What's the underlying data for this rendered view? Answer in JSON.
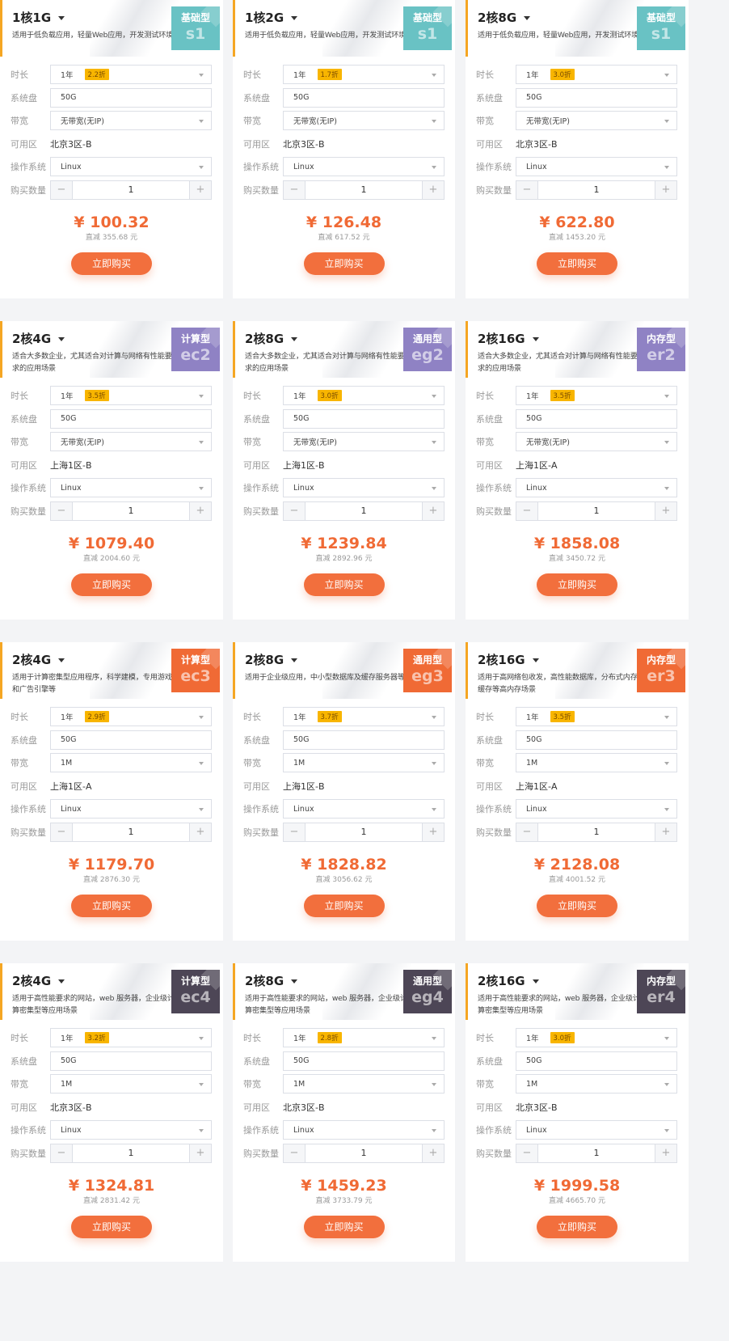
{
  "row_labels": {
    "duration": "时长",
    "disk": "系统盘",
    "bandwidth": "带宽",
    "zone": "可用区",
    "os": "操作系统",
    "quantity": "购买数量"
  },
  "cards": [
    {
      "spec": "1核1G",
      "desc": "适用于低负载应用，轻量Web应用，开发测试环境",
      "type": "基础型",
      "code": "s1",
      "badge_color": "#69c2c4",
      "duration": "1年",
      "discount": "2.2折",
      "disk": "50G",
      "bandwidth": "无带宽(无IP)",
      "zone": "北京3区-B",
      "os": "Linux",
      "qty": "1",
      "price": "¥ 100.32",
      "save": "直减 355.68 元",
      "buy": "立即购买"
    },
    {
      "spec": "1核2G",
      "desc": "适用于低负载应用，轻量Web应用，开发测试环境",
      "type": "基础型",
      "code": "s1",
      "badge_color": "#69c2c4",
      "duration": "1年",
      "discount": "1.7折",
      "disk": "50G",
      "bandwidth": "无带宽(无IP)",
      "zone": "北京3区-B",
      "os": "Linux",
      "qty": "1",
      "price": "¥ 126.48",
      "save": "直减 617.52 元",
      "buy": "立即购买"
    },
    {
      "spec": "2核8G",
      "desc": "适用于低负载应用，轻量Web应用，开发测试环境",
      "type": "基础型",
      "code": "s1",
      "badge_color": "#69c2c4",
      "duration": "1年",
      "discount": "3.0折",
      "disk": "50G",
      "bandwidth": "无带宽(无IP)",
      "zone": "北京3区-B",
      "os": "Linux",
      "qty": "1",
      "price": "¥ 622.80",
      "save": "直减 1453.20 元",
      "buy": "立即购买"
    },
    {
      "spec": "2核4G",
      "desc": "适合大多数企业，尤其适合对计算与网络有性能要求的应用场景",
      "type": "计算型",
      "code": "ec2",
      "badge_color": "#8f82c4",
      "duration": "1年",
      "discount": "3.5折",
      "disk": "50G",
      "bandwidth": "无带宽(无IP)",
      "zone": "上海1区-B",
      "os": "Linux",
      "qty": "1",
      "price": "¥ 1079.40",
      "save": "直减 2004.60 元",
      "buy": "立即购买"
    },
    {
      "spec": "2核8G",
      "desc": "适合大多数企业，尤其适合对计算与网络有性能要求的应用场景",
      "type": "通用型",
      "code": "eg2",
      "badge_color": "#8f82c4",
      "duration": "1年",
      "discount": "3.0折",
      "disk": "50G",
      "bandwidth": "无带宽(无IP)",
      "zone": "上海1区-B",
      "os": "Linux",
      "qty": "1",
      "price": "¥ 1239.84",
      "save": "直减 2892.96 元",
      "buy": "立即购买"
    },
    {
      "spec": "2核16G",
      "desc": "适合大多数企业，尤其适合对计算与网络有性能要求的应用场景",
      "type": "内存型",
      "code": "er2",
      "badge_color": "#8f82c4",
      "duration": "1年",
      "discount": "3.5折",
      "disk": "50G",
      "bandwidth": "无带宽(无IP)",
      "zone": "上海1区-A",
      "os": "Linux",
      "qty": "1",
      "price": "¥ 1858.08",
      "save": "直减 3450.72 元",
      "buy": "立即购买"
    },
    {
      "spec": "2核4G",
      "desc": "适用于计算密集型应用程序，科学建模，专用游戏和广告引擎等",
      "type": "计算型",
      "code": "ec3",
      "badge_color": "#f06a35",
      "duration": "1年",
      "discount": "2.9折",
      "disk": "50G",
      "bandwidth": "1M",
      "zone": "上海1区-A",
      "os": "Linux",
      "qty": "1",
      "price": "¥ 1179.70",
      "save": "直减 2876.30 元",
      "buy": "立即购买"
    },
    {
      "spec": "2核8G",
      "desc": "适用于企业级应用，中小型数据库及缓存服务器等",
      "type": "通用型",
      "code": "eg3",
      "badge_color": "#f06a35",
      "duration": "1年",
      "discount": "3.7折",
      "disk": "50G",
      "bandwidth": "1M",
      "zone": "上海1区-B",
      "os": "Linux",
      "qty": "1",
      "price": "¥ 1828.82",
      "save": "直减 3056.62 元",
      "buy": "立即购买"
    },
    {
      "spec": "2核16G",
      "desc": "适用于高网络包收发，高性能数据库，分布式内存缓存等高内存场景",
      "type": "内存型",
      "code": "er3",
      "badge_color": "#f06a35",
      "duration": "1年",
      "discount": "3.5折",
      "disk": "50G",
      "bandwidth": "1M",
      "zone": "上海1区-A",
      "os": "Linux",
      "qty": "1",
      "price": "¥ 2128.08",
      "save": "直减 4001.52 元",
      "buy": "立即购买"
    },
    {
      "spec": "2核4G",
      "desc": "适用于高性能要求的网站，web 服务器，企业级计算密集型等应用场景",
      "type": "计算型",
      "code": "ec4",
      "badge_color": "#4d4656",
      "duration": "1年",
      "discount": "3.2折",
      "disk": "50G",
      "bandwidth": "1M",
      "zone": "北京3区-B",
      "os": "Linux",
      "qty": "1",
      "price": "¥ 1324.81",
      "save": "直减 2831.42 元",
      "buy": "立即购买"
    },
    {
      "spec": "2核8G",
      "desc": "适用于高性能要求的网站，web 服务器，企业级计算密集型等应用场景",
      "type": "通用型",
      "code": "eg4",
      "badge_color": "#4d4656",
      "duration": "1年",
      "discount": "2.8折",
      "disk": "50G",
      "bandwidth": "1M",
      "zone": "北京3区-B",
      "os": "Linux",
      "qty": "1",
      "price": "¥ 1459.23",
      "save": "直减 3733.79 元",
      "buy": "立即购买"
    },
    {
      "spec": "2核16G",
      "desc": "适用于高性能要求的网站，web 服务器，企业级计算密集型等应用场景",
      "type": "内存型",
      "code": "er4",
      "badge_color": "#4d4656",
      "duration": "1年",
      "discount": "3.0折",
      "disk": "50G",
      "bandwidth": "1M",
      "zone": "北京3区-B",
      "os": "Linux",
      "qty": "1",
      "price": "¥ 1999.58",
      "save": "直减 4665.70 元",
      "buy": "立即购买"
    }
  ]
}
